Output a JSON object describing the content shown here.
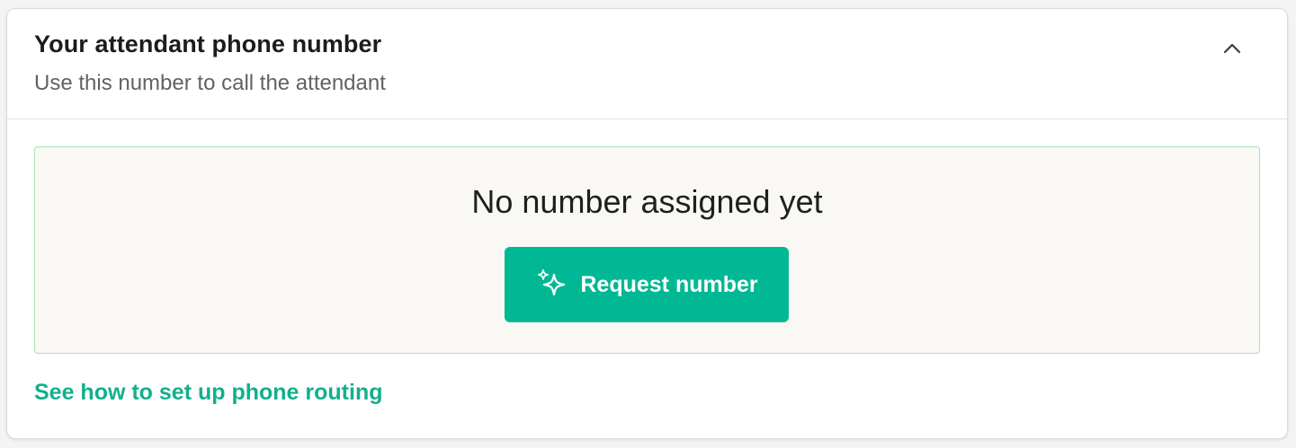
{
  "card": {
    "title": "Your attendant phone number",
    "subtitle": "Use this number to call the attendant",
    "collapse_icon": "chevron-up-icon"
  },
  "empty_state": {
    "message": "No number assigned yet",
    "button_label": "Request number",
    "button_icon": "sparkle-icon"
  },
  "help_link": {
    "label": "See how to set up phone routing"
  },
  "colors": {
    "accent": "#00b894",
    "link": "#12b08d",
    "panel_background": "#f9f8f5",
    "panel_border": "#a9e2b3"
  }
}
